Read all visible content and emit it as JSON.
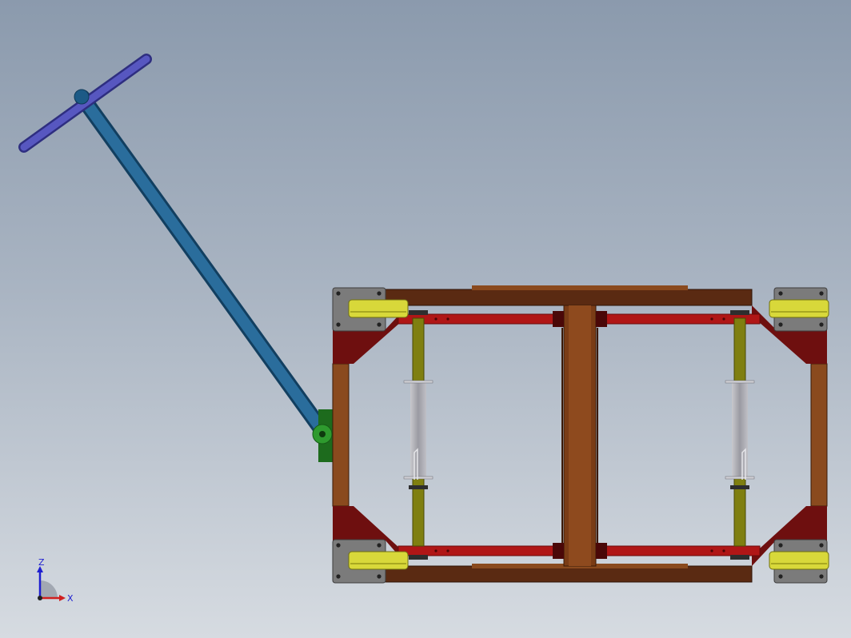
{
  "view": {
    "background_top": "#8b9aad",
    "background_bottom": "#d6dbe1"
  },
  "colors": {
    "frame": "#5a2a12",
    "frame_light": "#8a4a1e",
    "gusset": "#6e0f0f",
    "rail": "#b01616",
    "axle": "#7f7f10",
    "roller": "#d8d83a",
    "caster_plate": "#7b7b7b",
    "handle": "#1f5a86",
    "grip": "#4a4ab0",
    "hinge": "#2e8a2e",
    "sleeve": "#a2a2a8"
  },
  "triad": {
    "axis_z": "Z",
    "axis_x": "X",
    "icon": "coordinate-triad-icon"
  }
}
